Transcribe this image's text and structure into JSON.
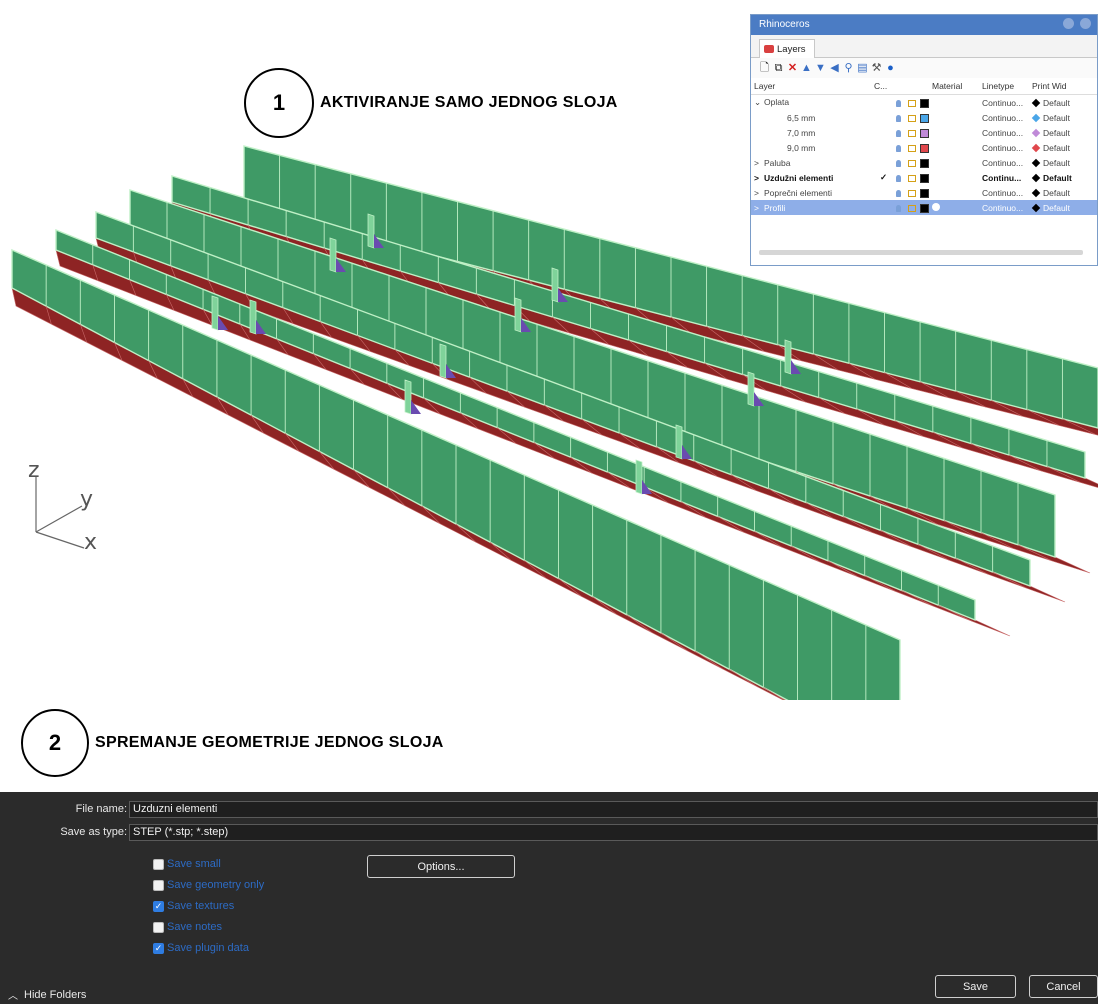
{
  "steps": [
    {
      "number": "1",
      "label": "AKTIVIRANJE  SAMO JEDNOG  SLOJA"
    },
    {
      "number": "2",
      "label": "SPREMANJE  GEOMETRIJE  JEDNOG  SLOJA"
    }
  ],
  "axes": {
    "z": "z",
    "y": "y",
    "x": "x"
  },
  "colors": {
    "panel_face": "#3f9a66",
    "panel_base": "#8e2424",
    "panel_edge": "#bff0c6",
    "stiffener_purple": "#6a4bb0"
  },
  "layers_panel": {
    "window_title": "Rhinoceros",
    "tab_label": "Layers",
    "columns": [
      "Layer",
      "C...",
      "",
      "",
      "",
      "Material",
      "Linetype",
      "Print Wid"
    ],
    "rows": [
      {
        "name": "Oplata",
        "expander": "⌄",
        "indent": 0,
        "current": "",
        "color": "#000000",
        "linetype": "Continuo...",
        "print_width": "Default",
        "diamond": "#000000",
        "style": "normal"
      },
      {
        "name": "6,5 mm",
        "expander": "",
        "indent": 1,
        "current": "",
        "color": "#4aa6e8",
        "linetype": "Continuo...",
        "print_width": "Default",
        "diamond": "#4aa6e8",
        "style": "normal"
      },
      {
        "name": "7,0 mm",
        "expander": "",
        "indent": 1,
        "current": "",
        "color": "#c08ad8",
        "linetype": "Continuo...",
        "print_width": "Default",
        "diamond": "#c08ad8",
        "style": "normal"
      },
      {
        "name": "9,0 mm",
        "expander": "",
        "indent": 1,
        "current": "",
        "color": "#e0474c",
        "linetype": "Continuo...",
        "print_width": "Default",
        "diamond": "#e0474c",
        "style": "normal"
      },
      {
        "name": "Paluba",
        "expander": ">",
        "indent": 0,
        "current": "",
        "color": "#000000",
        "linetype": "Continuo...",
        "print_width": "Default",
        "diamond": "#000000",
        "style": "normal"
      },
      {
        "name": "Uzdužni elementi",
        "expander": ">",
        "indent": 0,
        "current": "✓",
        "color": "#000000",
        "linetype": "Continu...",
        "print_width": "Default",
        "diamond": "#000000",
        "style": "bold"
      },
      {
        "name": "Poprečni elementi",
        "expander": ">",
        "indent": 0,
        "current": "",
        "color": "#000000",
        "linetype": "Continuo...",
        "print_width": "Default",
        "diamond": "#000000",
        "style": "normal"
      },
      {
        "name": "Profili",
        "expander": ">",
        "indent": 0,
        "current": "",
        "color": "#000000",
        "linetype": "Continuo...",
        "print_width": "Default",
        "diamond": "#000000",
        "style": "selected"
      }
    ]
  },
  "save_dialog": {
    "file_name_label": "File name:",
    "file_name_value": "Uzduzni elementi",
    "save_as_type_label": "Save as type:",
    "save_as_type_value": "STEP (*.stp; *.step)",
    "options_button": "Options...",
    "options": [
      {
        "label": "Save small",
        "checked": false
      },
      {
        "label": "Save geometry only",
        "checked": false
      },
      {
        "label": "Save textures",
        "checked": true
      },
      {
        "label": "Save notes",
        "checked": false
      },
      {
        "label": "Save plugin data",
        "checked": true
      }
    ],
    "hide_folders": "Hide Folders",
    "save_button": "Save",
    "cancel_button": "Cancel"
  }
}
